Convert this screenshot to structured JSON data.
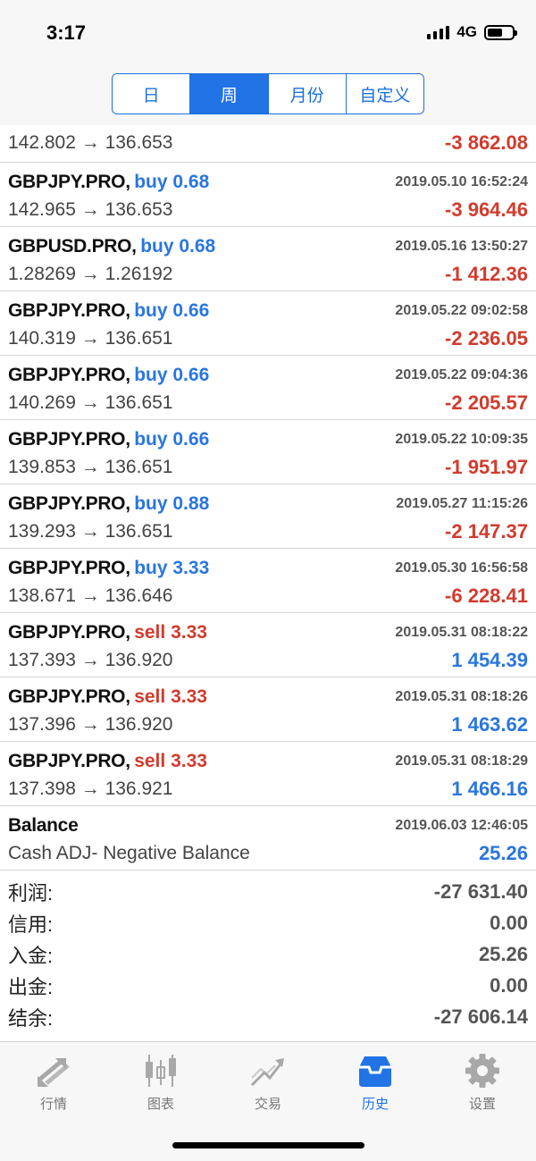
{
  "status_bar": {
    "time": "3:17",
    "network": "4G"
  },
  "period_tabs": [
    {
      "label": "日",
      "active": false
    },
    {
      "label": "周",
      "active": true
    },
    {
      "label": "月份",
      "active": false
    },
    {
      "label": "自定义",
      "active": false
    }
  ],
  "history": {
    "partial_row": {
      "prices": "142.802 → 136.653",
      "profit": "-3 862.08"
    },
    "rows": [
      {
        "symbol": "GBPJPY.PRO,",
        "side": "buy 0.68",
        "time": "2019.05.10 16:52:24",
        "prices": "142.965 → 136.653",
        "profit": "-3 964.46"
      },
      {
        "symbol": "GBPUSD.PRO,",
        "side": "buy 0.68",
        "time": "2019.05.16 13:50:27",
        "prices": "1.28269 → 1.26192",
        "profit": "-1 412.36"
      },
      {
        "symbol": "GBPJPY.PRO,",
        "side": "buy 0.66",
        "time": "2019.05.22 09:02:58",
        "prices": "140.319 → 136.651",
        "profit": "-2 236.05"
      },
      {
        "symbol": "GBPJPY.PRO,",
        "side": "buy 0.66",
        "time": "2019.05.22 09:04:36",
        "prices": "140.269 → 136.651",
        "profit": "-2 205.57"
      },
      {
        "symbol": "GBPJPY.PRO,",
        "side": "buy 0.66",
        "time": "2019.05.22 10:09:35",
        "prices": "139.853 → 136.651",
        "profit": "-1 951.97"
      },
      {
        "symbol": "GBPJPY.PRO,",
        "side": "buy 0.88",
        "time": "2019.05.27 11:15:26",
        "prices": "139.293 → 136.651",
        "profit": "-2 147.37"
      },
      {
        "symbol": "GBPJPY.PRO,",
        "side": "buy 3.33",
        "time": "2019.05.30 16:56:58",
        "prices": "138.671 → 136.646",
        "profit": "-6 228.41"
      },
      {
        "symbol": "GBPJPY.PRO,",
        "side": "sell 3.33",
        "time": "2019.05.31 08:18:22",
        "prices": "137.393 → 136.920",
        "profit": "1 454.39"
      },
      {
        "symbol": "GBPJPY.PRO,",
        "side": "sell 3.33",
        "time": "2019.05.31 08:18:26",
        "prices": "137.396 → 136.920",
        "profit": "1 463.62"
      },
      {
        "symbol": "GBPJPY.PRO,",
        "side": "sell 3.33",
        "time": "2019.05.31 08:18:29",
        "prices": "137.398 → 136.921",
        "profit": "1 466.16"
      },
      {
        "symbol": "Balance",
        "side": "",
        "time": "2019.06.03 12:46:05",
        "prices": "Cash ADJ- Negative Balance",
        "profit": "25.26"
      }
    ]
  },
  "summary": [
    {
      "label": "利润:",
      "value": "-27 631.40"
    },
    {
      "label": "信用:",
      "value": "0.00"
    },
    {
      "label": "入金:",
      "value": "25.26"
    },
    {
      "label": "出金:",
      "value": "0.00"
    },
    {
      "label": "结余:",
      "value": "-27 606.14"
    }
  ],
  "tabbar": [
    {
      "label": "行情",
      "icon": "quotes-arrows-icon",
      "active": false
    },
    {
      "label": "图表",
      "icon": "candlestick-chart-icon",
      "active": false
    },
    {
      "label": "交易",
      "icon": "trade-chart-icon",
      "active": false
    },
    {
      "label": "历史",
      "icon": "history-inbox-icon",
      "active": true
    },
    {
      "label": "设置",
      "icon": "gear-icon",
      "active": false
    }
  ],
  "colors": {
    "accent": "#2173e6",
    "loss": "#d23b2c",
    "gain": "#2a76e0",
    "inactive_icon": "#a8a8a8"
  }
}
